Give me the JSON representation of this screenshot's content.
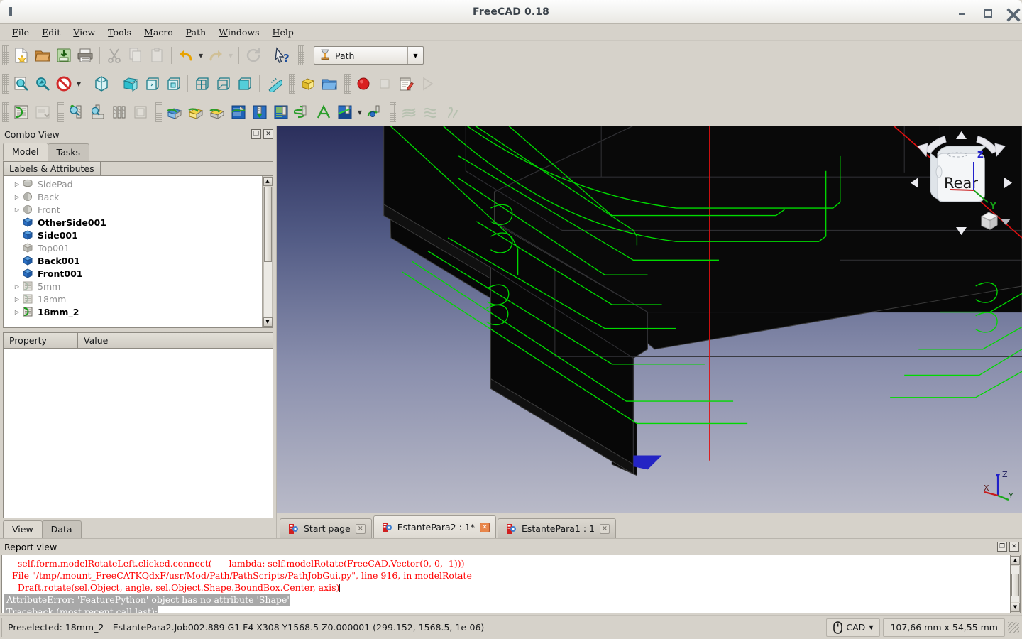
{
  "window": {
    "title": "FreeCAD 0.18",
    "controls": {
      "minimize": "–",
      "maximize": "□",
      "close": "✕"
    }
  },
  "menubar": {
    "items": [
      {
        "label": "File"
      },
      {
        "label": "Edit"
      },
      {
        "label": "View"
      },
      {
        "label": "Tools"
      },
      {
        "label": "Macro"
      },
      {
        "label": "Path"
      },
      {
        "label": "Windows"
      },
      {
        "label": "Help"
      }
    ]
  },
  "toolbars": {
    "file": {
      "buttons": [
        {
          "name": "new-document",
          "icon": "new-file-icon",
          "enabled": true
        },
        {
          "name": "open-document",
          "icon": "open-folder-icon",
          "enabled": true
        },
        {
          "name": "save-document",
          "icon": "save-disk-icon",
          "enabled": true
        },
        {
          "name": "print-document",
          "icon": "printer-icon",
          "enabled": true
        },
        {
          "name": "cut",
          "icon": "scissors-icon",
          "enabled": false
        },
        {
          "name": "copy",
          "icon": "copy-icon",
          "enabled": false
        },
        {
          "name": "paste",
          "icon": "clipboard-icon",
          "enabled": false
        },
        {
          "name": "undo",
          "icon": "undo-arrow-icon",
          "enabled": true
        },
        {
          "name": "redo",
          "icon": "redo-arrow-icon",
          "enabled": false
        },
        {
          "name": "refresh",
          "icon": "refresh-icon",
          "enabled": false
        },
        {
          "name": "whats-this",
          "icon": "whats-this-icon",
          "enabled": true
        }
      ]
    },
    "workbench": {
      "label": "Path",
      "icon": "path-workbench-icon"
    },
    "view": {
      "buttons": [
        {
          "name": "fit-all",
          "icon": "fit-all-icon"
        },
        {
          "name": "fit-selection",
          "icon": "fit-selection-icon"
        },
        {
          "name": "draw-style",
          "icon": "draw-style-icon"
        },
        {
          "name": "axonometric-view",
          "icon": "isometric-cube-icon"
        },
        {
          "name": "front-view",
          "icon": "front-view-cube-icon"
        },
        {
          "name": "top-view",
          "icon": "top-view-cube-icon"
        },
        {
          "name": "right-view",
          "icon": "right-view-cube-icon"
        },
        {
          "name": "rear-view",
          "icon": "rear-view-cube-icon"
        },
        {
          "name": "bottom-view",
          "icon": "bottom-view-cube-icon"
        },
        {
          "name": "left-view",
          "icon": "left-view-cube-icon"
        },
        {
          "name": "measure",
          "icon": "ruler-icon"
        }
      ]
    },
    "structure": {
      "buttons": [
        {
          "name": "create-part",
          "icon": "yellow-part-icon"
        },
        {
          "name": "create-group",
          "icon": "blue-folder-icon"
        }
      ]
    },
    "macro": {
      "buttons": [
        {
          "name": "macro-record",
          "icon": "record-circle-icon",
          "enabled": true
        },
        {
          "name": "macro-stop",
          "icon": "stop-square-icon",
          "enabled": false
        },
        {
          "name": "macros-dialog",
          "icon": "notepad-pencil-icon",
          "enabled": true
        },
        {
          "name": "execute-macro",
          "icon": "play-triangle-icon",
          "enabled": false
        }
      ]
    },
    "path_job": {
      "buttons": [
        {
          "name": "path-job",
          "icon": "path-job-icon"
        },
        {
          "name": "post-process",
          "icon": "post-process-icon"
        }
      ]
    },
    "path_tool": {
      "buttons": [
        {
          "name": "tool-bit-library",
          "icon": "toolbit-library-icon"
        },
        {
          "name": "tool-bit-dock",
          "icon": "toolbit-dock-icon"
        },
        {
          "name": "tool-bit-list",
          "icon": "drill-bits-icon"
        },
        {
          "name": "tool-bit-shape",
          "icon": "toolbit-shape-icon"
        }
      ]
    },
    "path_ops": {
      "buttons": [
        {
          "name": "profile-op",
          "icon": "profile-icon"
        },
        {
          "name": "pocket-shape-op",
          "icon": "pocket-shape-icon"
        },
        {
          "name": "face-op",
          "icon": "face-icon"
        },
        {
          "name": "adaptive-op",
          "icon": "adaptive-icon"
        },
        {
          "name": "drilling-op",
          "icon": "drilling-icon"
        },
        {
          "name": "surface-op",
          "icon": "surface-icon"
        },
        {
          "name": "helix-op",
          "icon": "helix-icon"
        },
        {
          "name": "engrave-op",
          "icon": "engrave-icon"
        },
        {
          "name": "slot-op",
          "icon": "slot-icon"
        },
        {
          "name": "deburr-op",
          "icon": "deburr-icon"
        }
      ]
    },
    "path_mod": {
      "buttons": [
        {
          "name": "copy-operation",
          "icon": "copy-op-icon",
          "enabled": false
        },
        {
          "name": "array-operation",
          "icon": "array-op-icon",
          "enabled": false
        },
        {
          "name": "simple-copy",
          "icon": "simple-copy-icon",
          "enabled": false
        }
      ]
    }
  },
  "combo_view": {
    "title": "Combo View",
    "float_icon": "float-window-icon",
    "close_icon": "close-panel-icon",
    "tabs": [
      {
        "label": "Model",
        "active": true
      },
      {
        "label": "Tasks",
        "active": false
      }
    ],
    "tree": {
      "header": "Labels & Attributes",
      "items": [
        {
          "label": "SidePad",
          "icon": "pad-icon",
          "expandable": true,
          "greyed": true,
          "bold": false
        },
        {
          "label": "Back",
          "icon": "sphere-icon",
          "expandable": true,
          "greyed": true,
          "bold": false
        },
        {
          "label": "Front",
          "icon": "sphere-icon",
          "expandable": true,
          "greyed": true,
          "bold": false
        },
        {
          "label": "OtherSide001",
          "icon": "box-blue-icon",
          "expandable": false,
          "greyed": false,
          "bold": true
        },
        {
          "label": "Side001",
          "icon": "box-blue-icon",
          "expandable": false,
          "greyed": false,
          "bold": true
        },
        {
          "label": "Top001",
          "icon": "box-grey-icon",
          "expandable": false,
          "greyed": true,
          "bold": false
        },
        {
          "label": "Back001",
          "icon": "box-blue-icon",
          "expandable": false,
          "greyed": false,
          "bold": true
        },
        {
          "label": "Front001",
          "icon": "box-blue-icon",
          "expandable": false,
          "greyed": false,
          "bold": true
        },
        {
          "label": "5mm",
          "icon": "job-grey-icon",
          "expandable": true,
          "greyed": true,
          "bold": false
        },
        {
          "label": "18mm",
          "icon": "job-grey-icon",
          "expandable": true,
          "greyed": true,
          "bold": false
        },
        {
          "label": "18mm_2",
          "icon": "job-green-icon",
          "expandable": true,
          "greyed": false,
          "bold": true
        }
      ]
    },
    "property_editor": {
      "columns": [
        "Property",
        "Value"
      ],
      "rows": []
    },
    "bottom_tabs": [
      {
        "label": "View",
        "active": true
      },
      {
        "label": "Data",
        "active": false
      }
    ]
  },
  "viewport": {
    "nav_cube": {
      "face_label": "Rear",
      "axis_z": "Z",
      "axis_y": "Y",
      "arrow_left": "◀",
      "arrow_right": "▶",
      "arrow_up": "▲",
      "arrow_down": "▼"
    },
    "origin_axis": {
      "x": "X",
      "y": "Y",
      "z": "Z"
    },
    "colors": {
      "background_top": "#2b2f5c",
      "background_bottom": "#b9bac8",
      "toolpath_green": "#00d400",
      "rapid_red": "#e00000",
      "model_black": "#060606",
      "highlight_blue": "#2222bb"
    }
  },
  "document_tabs": [
    {
      "label": "Start page",
      "active": false,
      "icon": "freecad-doc-icon",
      "close_icon": "close-tab-icon"
    },
    {
      "label": "EstantePara2 : 1*",
      "active": true,
      "icon": "freecad-doc-icon",
      "close_icon": "close-tab-icon"
    },
    {
      "label": "EstantePara1 : 1",
      "active": false,
      "icon": "freecad-doc-icon",
      "close_icon": "close-tab-icon"
    }
  ],
  "report_view": {
    "title": "Report view",
    "float_icon": "float-window-icon",
    "close_icon": "close-panel-icon",
    "lines": [
      {
        "text": "    self.form.modelRotateLeft.clicked.connect(      lambda: self.modelRotate(FreeCAD.Vector(0, 0,  1)))",
        "selection": "none"
      },
      {
        "text": "  File \"/tmp/.mount_FreeCATKQdxF/usr/Mod/Path/PathScripts/PathJobGui.py\", line 916, in modelRotate",
        "selection": "none"
      },
      {
        "text": "    Draft.rotate(sel.Object, angle, sel.Object.Shape.BoundBox.Center, ",
        "selection": "partial",
        "selected_text": "axis)"
      },
      {
        "text": "AttributeError: 'FeaturePython' object has no attribute 'Shape'",
        "selection": "full"
      },
      {
        "text": "Traceback (most recent call last):",
        "selection": "full"
      }
    ]
  },
  "statusbar": {
    "message": "Preselected: 18mm_2 - EstantePara2.Job002.889 G1 F4 X308 Y1568.5 Z0.000001 (299.152, 1568.5, 1e-06)",
    "navigation": {
      "label": "CAD",
      "icon": "mouse-icon",
      "arrow": "▾"
    },
    "dimensions": "107,66 mm x 54,55 mm"
  }
}
